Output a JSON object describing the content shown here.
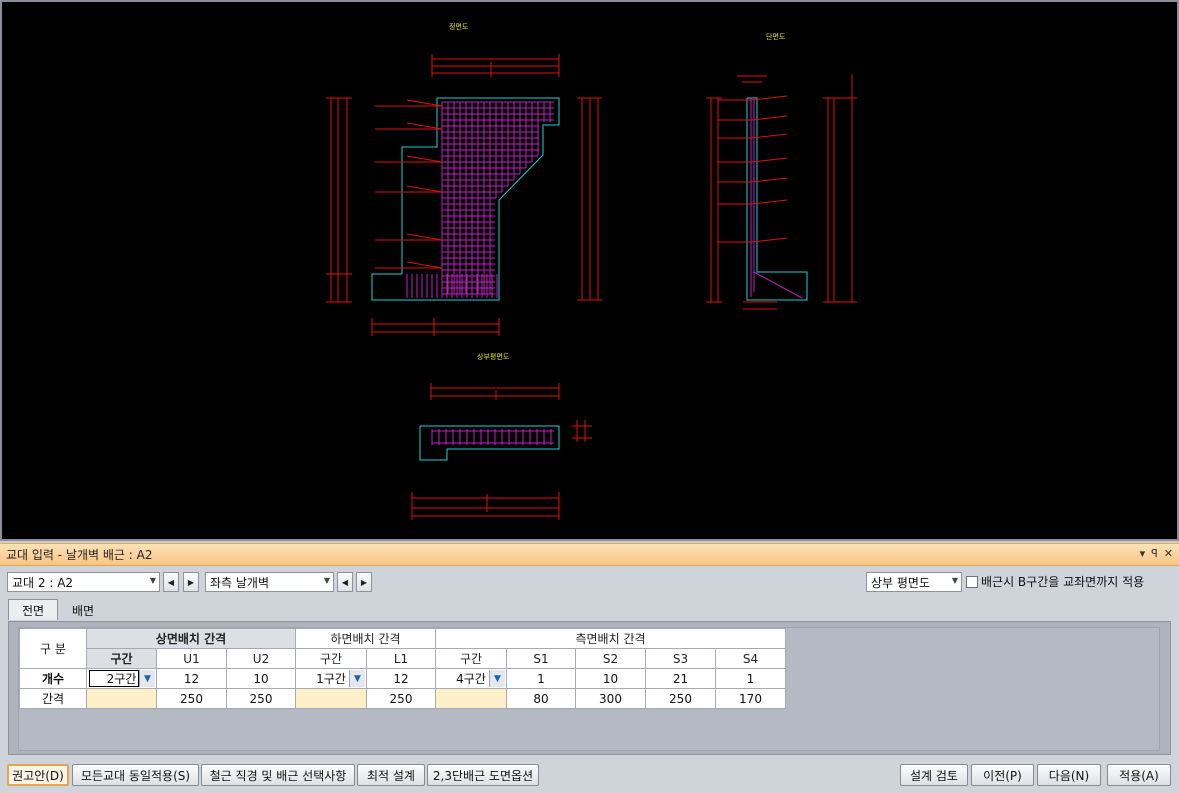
{
  "drawing": {
    "view_titles": [
      "정면도",
      "단면도",
      "상부평면도"
    ]
  },
  "panel": {
    "title": "교대 입력 - 날개벽 배근 : A2",
    "title_controls": [
      "▾",
      "ꟼ",
      "✕"
    ],
    "abutment_select": "교대 2 : A2",
    "wingwall_select": "좌측 날개벽",
    "view_select": "상부 평면도",
    "checkbox_label": "배근시 B구간을 교좌면까지 적용",
    "tabs": [
      "전면",
      "배면"
    ],
    "grid": {
      "corner": "구 분",
      "group_top": "상면배치 간격",
      "group_bottom": "하면배치 간격",
      "group_side": "측면배치 간격",
      "sub_headers": [
        "구간",
        "U1",
        "U2",
        "구간",
        "L1",
        "구간",
        "S1",
        "S2",
        "S3",
        "S4"
      ],
      "rows": [
        {
          "label": "개수",
          "cells": [
            "2구간",
            "12",
            "10",
            "1구간",
            "12",
            "4구간",
            "1",
            "10",
            "21",
            "1"
          ]
        },
        {
          "label": "간격",
          "cells": [
            "",
            "250",
            "250",
            "",
            "250",
            "",
            "80",
            "300",
            "250",
            "170"
          ]
        }
      ]
    },
    "buttons": {
      "recommend": "권고안(D)",
      "apply_all": "모든교대 동일적용(S)",
      "rebar_options": "철근 직경 및 배근 선택사항",
      "optimal": "최적 설계",
      "drawing_options": "2,3단배근 도면옵션",
      "design_check": "설계 검토",
      "prev": "이전(P)",
      "next": "다음(N)",
      "apply": "적용(A)"
    }
  },
  "colors": {
    "cad_background": "#000000",
    "titlebar": "#f7c585",
    "selected_cell": "#fdf0c8",
    "rebar": "#c020c0",
    "dimension": "#e01010",
    "outline": "#20d0d0"
  }
}
